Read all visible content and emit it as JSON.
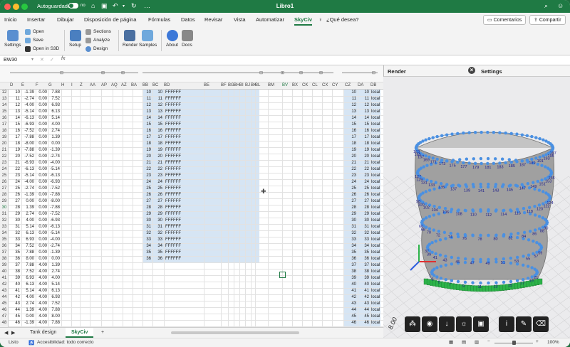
{
  "titlebar": {
    "autosave": "Autoguardado",
    "toggle_state": "no",
    "doc_title": "Libro1"
  },
  "menu": {
    "items": [
      "Inicio",
      "Insertar",
      "Dibujar",
      "Disposición de página",
      "Fórmulas",
      "Datos",
      "Revisar",
      "Vista",
      "Automatizar",
      "SkyCiv"
    ],
    "active": "SkyCiv",
    "tell_me": "¿Qué desea?",
    "comments": "Comentarios",
    "share": "Compartir"
  },
  "ribbon": {
    "settings": "Settings",
    "open": "Open",
    "save": "Save",
    "open_s3d": "Open in S3D",
    "setup": "Setup",
    "sections": "Sections",
    "analyze": "Analyze",
    "design": "Design",
    "render": "Render",
    "samples": "Samples",
    "about": "About",
    "docs": "Docs"
  },
  "formula": {
    "namebox": "BW30",
    "fx": "fx"
  },
  "sheet": {
    "col_headers_left": [
      "D",
      "E",
      "F",
      "G",
      "H",
      "I",
      "Z",
      "AA",
      "AP",
      "AQ",
      "AZ",
      "BA"
    ],
    "col_headers_mid": [
      "BB",
      "BC",
      "BD",
      "BE",
      "BF",
      "BG",
      "BH",
      "BI",
      "BJ",
      "BK",
      "BL",
      "BM",
      "BV",
      "BX",
      "CK",
      "CL",
      "CX",
      "CY"
    ],
    "col_headers_right": [
      "CZ",
      "DA",
      "DB"
    ],
    "rows": [
      {
        "r": "12",
        "d": "10",
        "e": "-1.39",
        "f": "0.00",
        "g": "7.88",
        "bb": "10",
        "bc": "10",
        "bd": "FFFFFF",
        "cz": "10",
        "da": "10",
        "db": "local"
      },
      {
        "r": "13",
        "d": "11",
        "e": "-2.74",
        "f": "0.00",
        "g": "7.52",
        "bb": "11",
        "bc": "11",
        "bd": "FFFFFF",
        "cz": "11",
        "da": "11",
        "db": "local"
      },
      {
        "r": "14",
        "d": "12",
        "e": "-4.00",
        "f": "0.00",
        "g": "6.93",
        "bb": "12",
        "bc": "12",
        "bd": "FFFFFF",
        "cz": "12",
        "da": "12",
        "db": "local"
      },
      {
        "r": "15",
        "d": "13",
        "e": "-5.14",
        "f": "0.00",
        "g": "6.13",
        "bb": "13",
        "bc": "13",
        "bd": "FFFFFF",
        "cz": "13",
        "da": "13",
        "db": "local"
      },
      {
        "r": "16",
        "d": "14",
        "e": "-6.13",
        "f": "0.00",
        "g": "5.14",
        "bb": "14",
        "bc": "14",
        "bd": "FFFFFF",
        "cz": "14",
        "da": "14",
        "db": "local"
      },
      {
        "r": "17",
        "d": "15",
        "e": "-6.93",
        "f": "0.00",
        "g": "4.00",
        "bb": "15",
        "bc": "15",
        "bd": "FFFFFF",
        "cz": "15",
        "da": "15",
        "db": "local"
      },
      {
        "r": "18",
        "d": "16",
        "e": "-7.52",
        "f": "0.00",
        "g": "2.74",
        "bb": "16",
        "bc": "16",
        "bd": "FFFFFF",
        "cz": "16",
        "da": "16",
        "db": "local"
      },
      {
        "r": "19",
        "d": "17",
        "e": "-7.88",
        "f": "0.00",
        "g": "1.39",
        "bb": "17",
        "bc": "17",
        "bd": "FFFFFF",
        "cz": "17",
        "da": "17",
        "db": "local"
      },
      {
        "r": "20",
        "d": "18",
        "e": "-8.00",
        "f": "0.00",
        "g": "0.00",
        "bb": "18",
        "bc": "18",
        "bd": "FFFFFF",
        "cz": "18",
        "da": "18",
        "db": "local"
      },
      {
        "r": "21",
        "d": "19",
        "e": "-7.88",
        "f": "0.00",
        "g": "-1.39",
        "bb": "19",
        "bc": "19",
        "bd": "FFFFFF",
        "cz": "19",
        "da": "19",
        "db": "local"
      },
      {
        "r": "22",
        "d": "20",
        "e": "-7.52",
        "f": "0.00",
        "g": "-2.74",
        "bb": "20",
        "bc": "20",
        "bd": "FFFFFF",
        "cz": "20",
        "da": "20",
        "db": "local"
      },
      {
        "r": "23",
        "d": "21",
        "e": "-6.93",
        "f": "0.00",
        "g": "-4.00",
        "bb": "21",
        "bc": "21",
        "bd": "FFFFFF",
        "cz": "21",
        "da": "21",
        "db": "local"
      },
      {
        "r": "24",
        "d": "22",
        "e": "-6.13",
        "f": "0.00",
        "g": "-5.14",
        "bb": "22",
        "bc": "22",
        "bd": "FFFFFF",
        "cz": "22",
        "da": "22",
        "db": "local"
      },
      {
        "r": "25",
        "d": "23",
        "e": "-5.14",
        "f": "0.00",
        "g": "-6.13",
        "bb": "23",
        "bc": "23",
        "bd": "FFFFFF",
        "cz": "23",
        "da": "23",
        "db": "local"
      },
      {
        "r": "26",
        "d": "24",
        "e": "-4.00",
        "f": "0.00",
        "g": "-6.93",
        "bb": "24",
        "bc": "24",
        "bd": "FFFFFF",
        "cz": "24",
        "da": "24",
        "db": "local"
      },
      {
        "r": "27",
        "d": "25",
        "e": "-2.74",
        "f": "0.00",
        "g": "-7.52",
        "bb": "25",
        "bc": "25",
        "bd": "FFFFFF",
        "cz": "25",
        "da": "25",
        "db": "local"
      },
      {
        "r": "28",
        "d": "26",
        "e": "-1.39",
        "f": "0.00",
        "g": "-7.88",
        "bb": "26",
        "bc": "26",
        "bd": "FFFFFF",
        "cz": "26",
        "da": "26",
        "db": "local"
      },
      {
        "r": "29",
        "d": "27",
        "e": "0.00",
        "f": "0.00",
        "g": "-8.00",
        "bb": "27",
        "bc": "27",
        "bd": "FFFFFF",
        "cz": "27",
        "da": "27",
        "db": "local"
      },
      {
        "r": "30",
        "d": "28",
        "e": "1.39",
        "f": "0.00",
        "g": "-7.88",
        "bb": "28",
        "bc": "28",
        "bd": "FFFFFF",
        "cz": "28",
        "da": "28",
        "db": "local"
      },
      {
        "r": "31",
        "d": "29",
        "e": "2.74",
        "f": "0.00",
        "g": "-7.52",
        "bb": "29",
        "bc": "29",
        "bd": "FFFFFF",
        "cz": "29",
        "da": "29",
        "db": "local"
      },
      {
        "r": "32",
        "d": "30",
        "e": "4.00",
        "f": "0.00",
        "g": "-6.93",
        "bb": "30",
        "bc": "30",
        "bd": "FFFFFF",
        "cz": "30",
        "da": "30",
        "db": "local"
      },
      {
        "r": "33",
        "d": "31",
        "e": "5.14",
        "f": "0.00",
        "g": "-6.13",
        "bb": "31",
        "bc": "31",
        "bd": "FFFFFF",
        "cz": "31",
        "da": "31",
        "db": "local"
      },
      {
        "r": "34",
        "d": "32",
        "e": "6.13",
        "f": "0.00",
        "g": "-5.14",
        "bb": "32",
        "bc": "32",
        "bd": "FFFFFF",
        "cz": "32",
        "da": "32",
        "db": "local"
      },
      {
        "r": "35",
        "d": "33",
        "e": "6.93",
        "f": "0.00",
        "g": "-4.00",
        "bb": "33",
        "bc": "33",
        "bd": "FFFFFF",
        "cz": "33",
        "da": "33",
        "db": "local"
      },
      {
        "r": "36",
        "d": "34",
        "e": "7.52",
        "f": "0.00",
        "g": "-2.74",
        "bb": "34",
        "bc": "34",
        "bd": "FFFFFF",
        "cz": "34",
        "da": "34",
        "db": "local"
      },
      {
        "r": "37",
        "d": "35",
        "e": "7.88",
        "f": "0.00",
        "g": "-1.39",
        "bb": "35",
        "bc": "35",
        "bd": "FFFFFF",
        "cz": "35",
        "da": "35",
        "db": "local"
      },
      {
        "r": "38",
        "d": "36",
        "e": "8.00",
        "f": "0.00",
        "g": "0.00",
        "bb": "36",
        "bc": "36",
        "bd": "FFFFFF",
        "cz": "36",
        "da": "36",
        "db": "local"
      },
      {
        "r": "39",
        "d": "37",
        "e": "7.88",
        "f": "4.00",
        "g": "1.39",
        "bb": "",
        "bc": "",
        "bd": "",
        "cz": "37",
        "da": "37",
        "db": "local"
      },
      {
        "r": "40",
        "d": "38",
        "e": "7.52",
        "f": "4.00",
        "g": "2.74",
        "bb": "",
        "bc": "",
        "bd": "",
        "cz": "38",
        "da": "38",
        "db": "local"
      },
      {
        "r": "41",
        "d": "39",
        "e": "6.93",
        "f": "4.00",
        "g": "4.00",
        "bb": "",
        "bc": "",
        "bd": "",
        "cz": "39",
        "da": "39",
        "db": "local"
      },
      {
        "r": "42",
        "d": "40",
        "e": "6.13",
        "f": "4.00",
        "g": "5.14",
        "bb": "",
        "bc": "",
        "bd": "",
        "cz": "40",
        "da": "40",
        "db": "local"
      },
      {
        "r": "43",
        "d": "41",
        "e": "5.14",
        "f": "4.00",
        "g": "6.13",
        "bb": "",
        "bc": "",
        "bd": "",
        "cz": "41",
        "da": "41",
        "db": "local"
      },
      {
        "r": "44",
        "d": "42",
        "e": "4.00",
        "f": "4.00",
        "g": "6.93",
        "bb": "",
        "bc": "",
        "bd": "",
        "cz": "42",
        "da": "42",
        "db": "local"
      },
      {
        "r": "45",
        "d": "43",
        "e": "2.74",
        "f": "4.00",
        "g": "7.52",
        "bb": "",
        "bc": "",
        "bd": "",
        "cz": "43",
        "da": "43",
        "db": "local"
      },
      {
        "r": "46",
        "d": "44",
        "e": "1.39",
        "f": "4.00",
        "g": "7.88",
        "bb": "",
        "bc": "",
        "bd": "",
        "cz": "44",
        "da": "44",
        "db": "local"
      },
      {
        "r": "47",
        "d": "45",
        "e": "0.00",
        "f": "4.00",
        "g": "8.00",
        "bb": "",
        "bc": "",
        "bd": "",
        "cz": "45",
        "da": "45",
        "db": "local"
      },
      {
        "r": "48",
        "d": "46",
        "e": "-1.39",
        "f": "4.00",
        "g": "7.88",
        "bb": "",
        "bc": "",
        "bd": "",
        "cz": "46",
        "da": "46",
        "db": "local"
      }
    ]
  },
  "tabs": {
    "items": [
      "Tank design",
      "SkyCiv"
    ],
    "active": "SkyCiv",
    "add": "+"
  },
  "status": {
    "ready": "Listo",
    "accessibility": "Accesibilidad: todo correcto",
    "zoom": "100%"
  },
  "render_pane": {
    "title": "Render",
    "close": "×",
    "refresh": "↻",
    "axis_label": "8.00"
  },
  "settings_pane": {
    "title": "Settings"
  },
  "colors": {
    "brand": "#1f7a44",
    "node": "#4a90e2",
    "support": "#2db34a",
    "surface": "#9a9a9a"
  }
}
